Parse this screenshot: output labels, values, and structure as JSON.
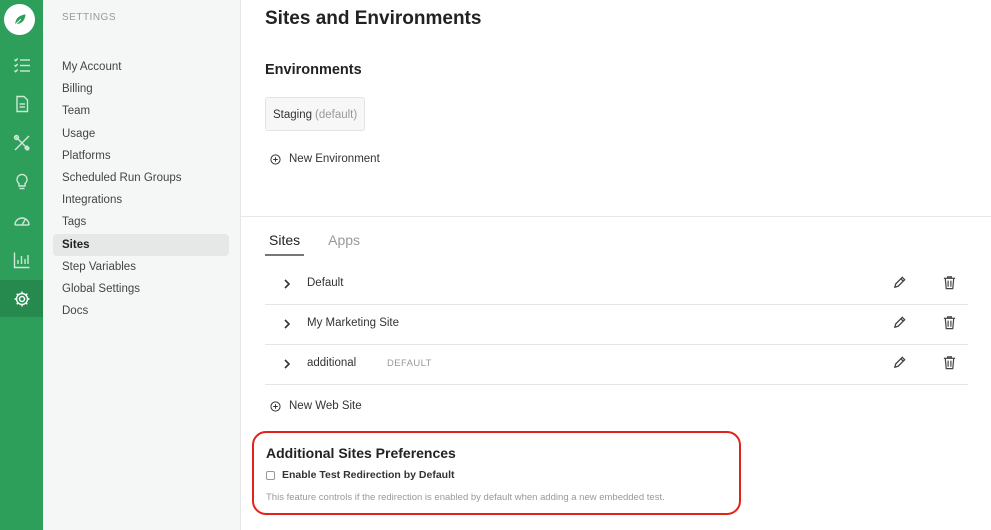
{
  "colors": {
    "rail": "#2e9e5b",
    "rail_active": "#268a4e",
    "highlight": "#e2231a"
  },
  "rail": {
    "logo_icon": "leaf-icon",
    "items": [
      {
        "icon": "checklist-icon",
        "active": false
      },
      {
        "icon": "document-icon",
        "active": false
      },
      {
        "icon": "tools-icon",
        "active": false
      },
      {
        "icon": "lightbulb-icon",
        "active": false
      },
      {
        "icon": "speedometer-icon",
        "active": false
      },
      {
        "icon": "bar-chart-icon",
        "active": false
      },
      {
        "icon": "gear-icon",
        "active": true
      }
    ]
  },
  "sidebar": {
    "heading": "SETTINGS",
    "items": [
      {
        "label": "My Account",
        "active": false
      },
      {
        "label": "Billing",
        "active": false
      },
      {
        "label": "Team",
        "active": false
      },
      {
        "label": "Usage",
        "active": false
      },
      {
        "label": "Platforms",
        "active": false
      },
      {
        "label": "Scheduled Run Groups",
        "active": false
      },
      {
        "label": "Integrations",
        "active": false
      },
      {
        "label": "Tags",
        "active": false
      },
      {
        "label": "Sites",
        "active": true
      },
      {
        "label": "Step Variables",
        "active": false
      },
      {
        "label": "Global Settings",
        "active": false
      },
      {
        "label": "Docs",
        "active": false
      }
    ]
  },
  "main": {
    "title": "Sites and Environments",
    "environments": {
      "heading": "Environments",
      "items": [
        {
          "name": "Staging",
          "tag": "(default)"
        }
      ],
      "add_label": "New Environment"
    },
    "tabs": [
      {
        "label": "Sites",
        "active": true
      },
      {
        "label": "Apps",
        "active": false
      }
    ],
    "sites": [
      {
        "name": "Default",
        "badge": ""
      },
      {
        "name": "My Marketing Site",
        "badge": ""
      },
      {
        "name": "additional",
        "badge": "DEFAULT"
      }
    ],
    "add_site_label": "New Web Site",
    "preferences": {
      "title": "Additional Sites Preferences",
      "checkbox_label": "Enable Test Redirection by Default",
      "checked": false,
      "help_text": "This feature controls if the redirection is enabled by default when adding a new embedded test."
    }
  }
}
